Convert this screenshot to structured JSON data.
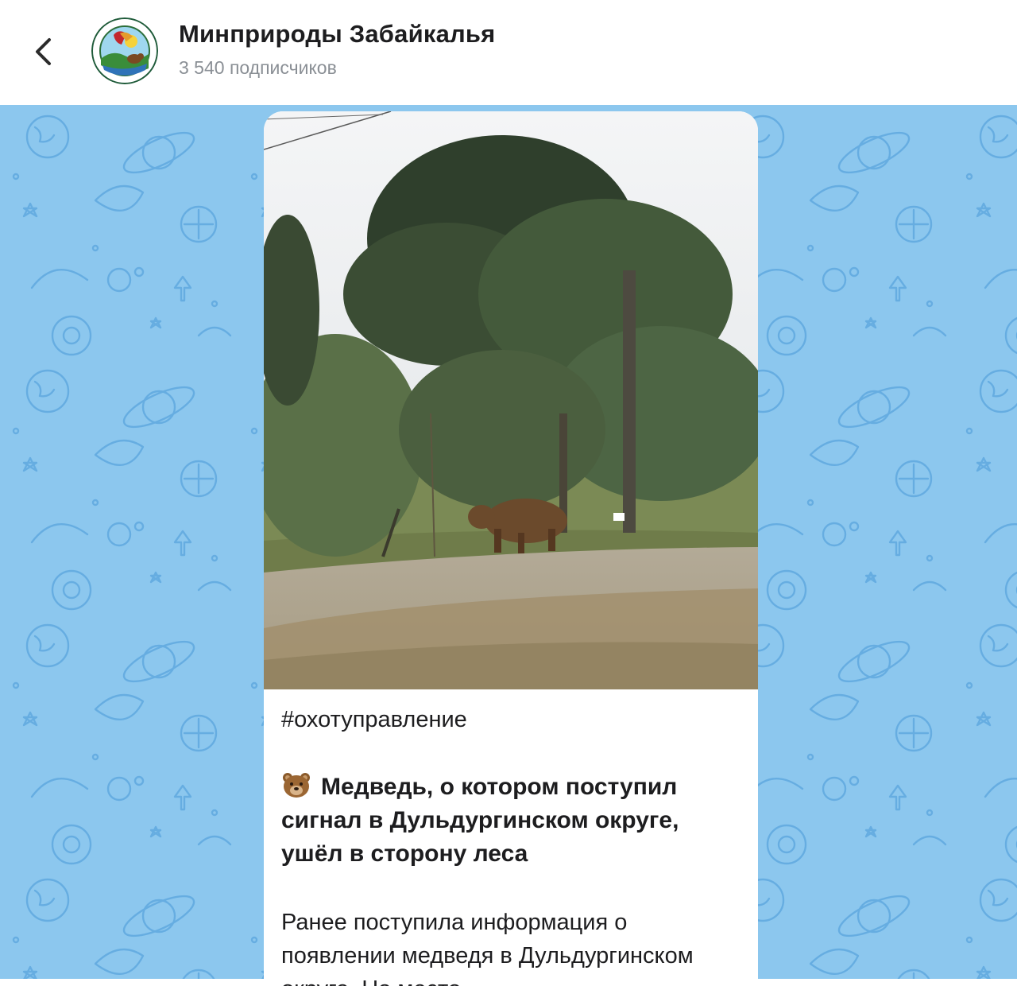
{
  "channel": {
    "name": "Минприроды Забайкалья",
    "subscribers": "3 540 подписчиков"
  },
  "post": {
    "hashtag": "#охотуправление",
    "headline": "Медведь, о котором поступил сигнал в Дульдургинском округе, ушёл в сторону леса",
    "body": "Ранее поступила информация о появлении медведя в Дульдургинском округе. На место"
  },
  "colors": {
    "chat_background": "#8cc7ee",
    "pattern_stroke": "#5fa8e0"
  },
  "icons": [
    "back-arrow-icon",
    "bear-emoji-icon"
  ]
}
